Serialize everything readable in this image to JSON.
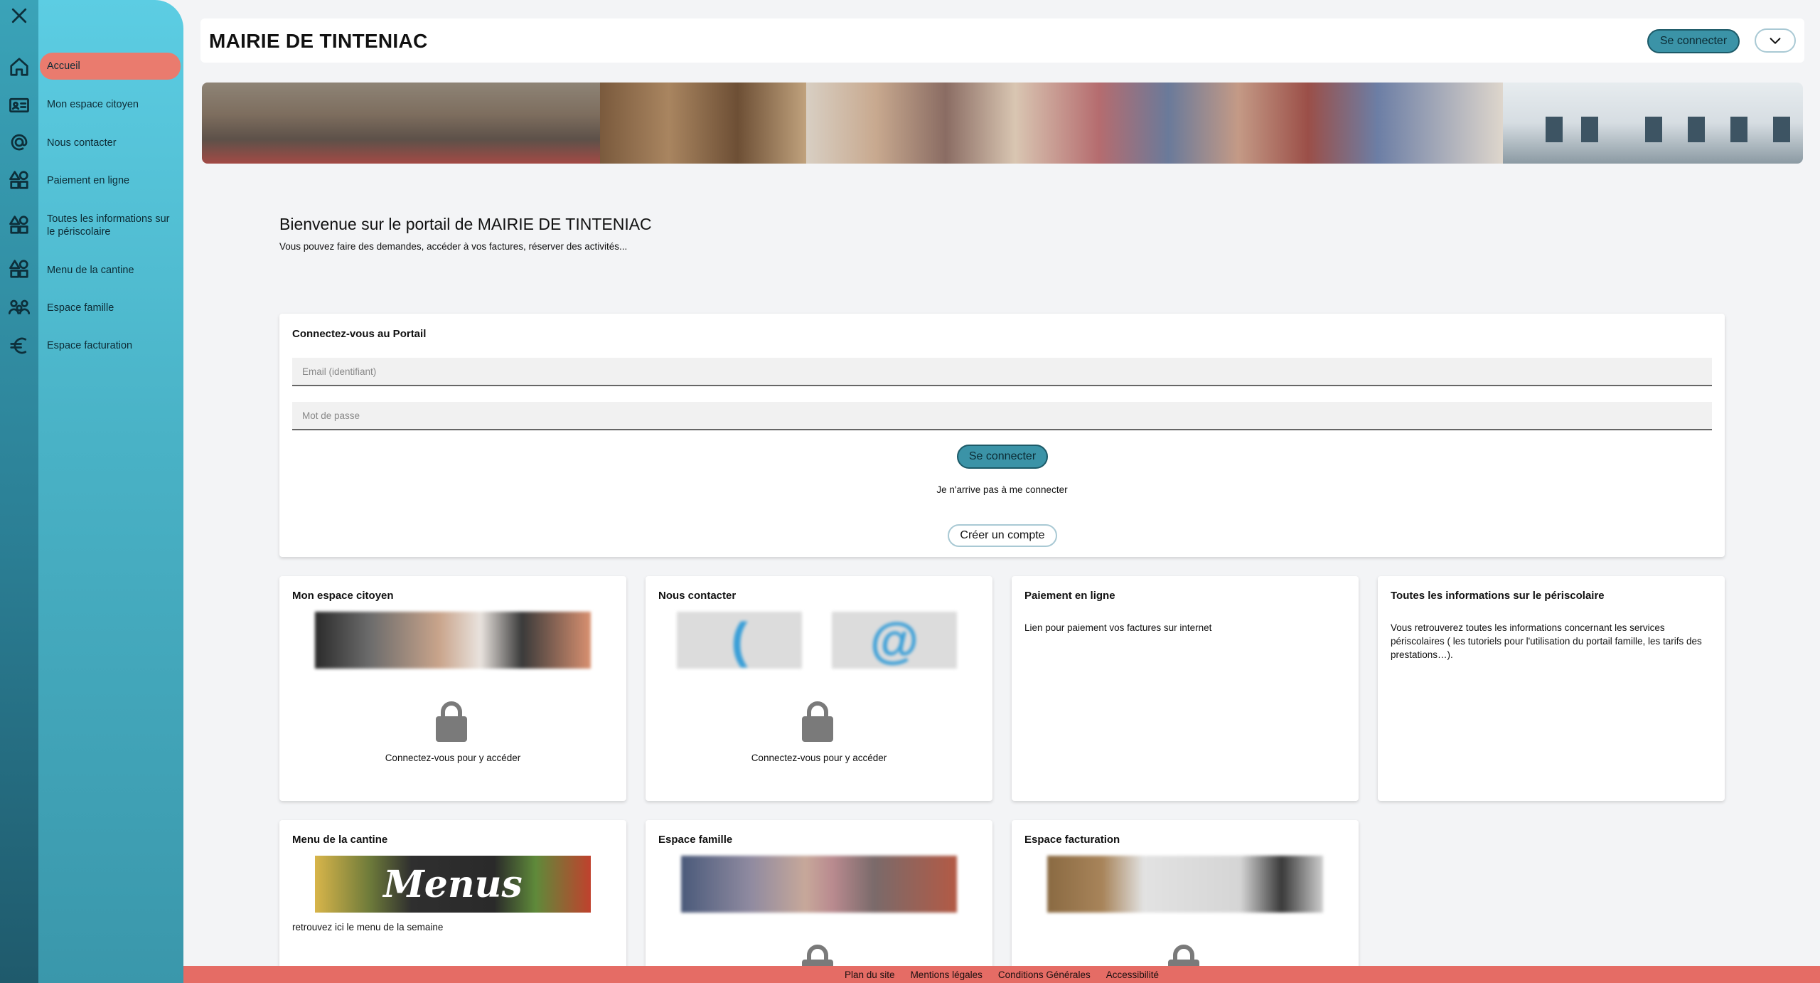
{
  "header": {
    "title": "MAIRIE DE TINTENIAC",
    "connect_label": "Se connecter"
  },
  "sidebar": {
    "items": [
      {
        "label": "Accueil",
        "icon": "home-icon",
        "active": true
      },
      {
        "label": "Mon espace citoyen",
        "icon": "id-card-icon"
      },
      {
        "label": "Nous contacter",
        "icon": "at-icon"
      },
      {
        "label": "Paiement en ligne",
        "icon": "shapes-icon"
      },
      {
        "label": "Toutes les informations sur le périscolaire",
        "icon": "shapes-icon"
      },
      {
        "label": "Menu de la cantine",
        "icon": "shapes-icon"
      },
      {
        "label": "Espace famille",
        "icon": "family-icon"
      },
      {
        "label": "Espace facturation",
        "icon": "euro-icon"
      }
    ]
  },
  "welcome": {
    "title": "Bienvenue sur le portail de MAIRIE DE TINTENIAC",
    "subtitle": "Vous pouvez faire des demandes, accéder à vos factures, réserver des activités..."
  },
  "login": {
    "title": "Connectez-vous au Portail",
    "email_placeholder": "Email (identifiant)",
    "password_placeholder": "Mot de passe",
    "submit_label": "Se connecter",
    "forgot_label": "Je n'arrive pas à me connecter",
    "create_label": "Créer un compte"
  },
  "tiles": [
    {
      "title": "Mon espace citoyen",
      "locked_text": "Connectez-vous pour y accéder"
    },
    {
      "title": "Nous contacter",
      "locked_text": "Connectez-vous pour y accéder"
    },
    {
      "title": "Paiement en ligne",
      "description": "Lien pour paiement vos factures sur internet"
    },
    {
      "title": "Toutes les informations sur le périscolaire",
      "description": "Vous retrouverez toutes les informations concernant les services périscolaires ( les tutoriels pour l'utilisation du portail famille, les tarifs des prestations…)."
    },
    {
      "title": "Menu de la cantine",
      "description": "retrouvez ici le menu de la semaine",
      "image_text": "Menus"
    },
    {
      "title": "Espace famille"
    },
    {
      "title": "Espace facturation"
    }
  ],
  "footer": {
    "links": [
      "Plan du site",
      "Mentions légales",
      "Conditions Générales",
      "Accessibilité"
    ]
  },
  "colors": {
    "accent": "#3b93a7",
    "active": "#ea7b6e",
    "footer": "#e56c65"
  }
}
